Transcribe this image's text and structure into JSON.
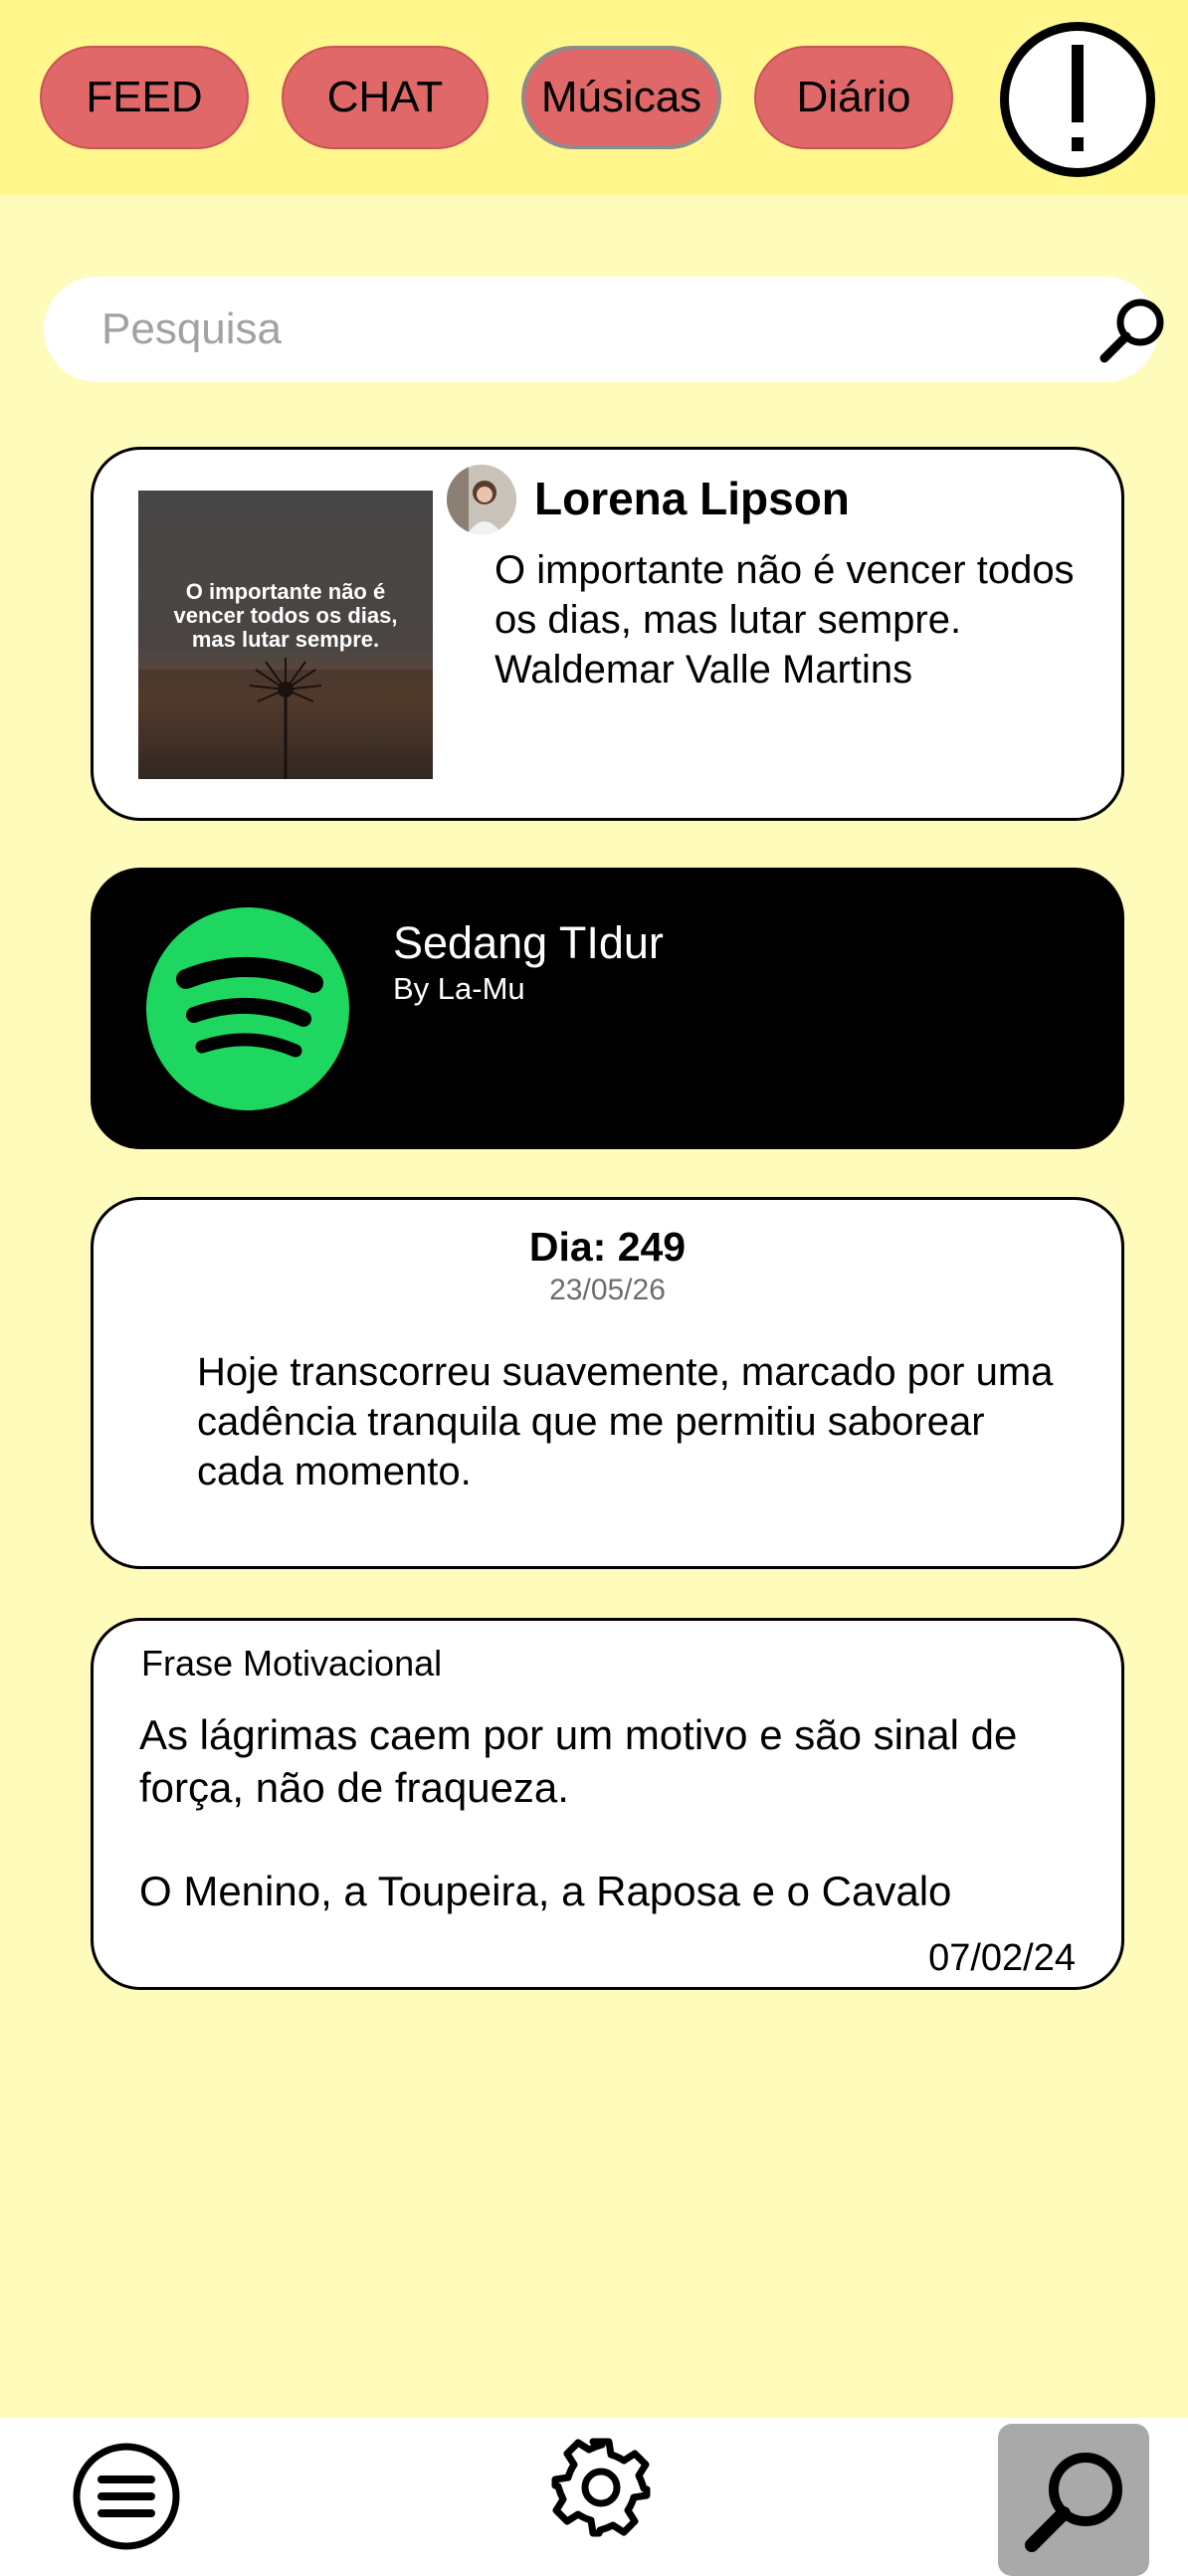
{
  "tabs": [
    {
      "label": "FEED"
    },
    {
      "label": "CHAT"
    },
    {
      "label": "Músicas"
    },
    {
      "label": "Diário"
    }
  ],
  "alert": {
    "icon": "exclamation-icon"
  },
  "search": {
    "placeholder": "Pesquisa",
    "value": ""
  },
  "post": {
    "author": "Lorena Lipson",
    "text": "O importante não é vencer todos os dias, mas lutar sempre. Waldemar Valle Martins",
    "image_text": "O importante não é vencer todos os dias, mas lutar sempre."
  },
  "music": {
    "title": "Sedang TIdur",
    "artist": "By La-Mu",
    "icon": "spotify-icon"
  },
  "diary": {
    "day": "Dia: 249",
    "date": "23/05/26",
    "text": "Hoje transcorreu suavemente, marcado por uma cadência tranquila que me permitiu saborear cada momento."
  },
  "motivation": {
    "label": "Frase Motivacional",
    "quote": "As lágrimas caem por um motivo e são sinal de força, não de fraqueza.",
    "source": "O Menino, a Toupeira, a Raposa e o Cavalo",
    "date": "07/02/24"
  },
  "bottom_nav": [
    {
      "icon": "menu-icon"
    },
    {
      "icon": "gear-icon"
    },
    {
      "icon": "search-icon"
    }
  ],
  "colors": {
    "background": "#fffbbb",
    "topbar": "#fff78c",
    "tab": "#e06868",
    "spotify_green": "#1ed760"
  }
}
